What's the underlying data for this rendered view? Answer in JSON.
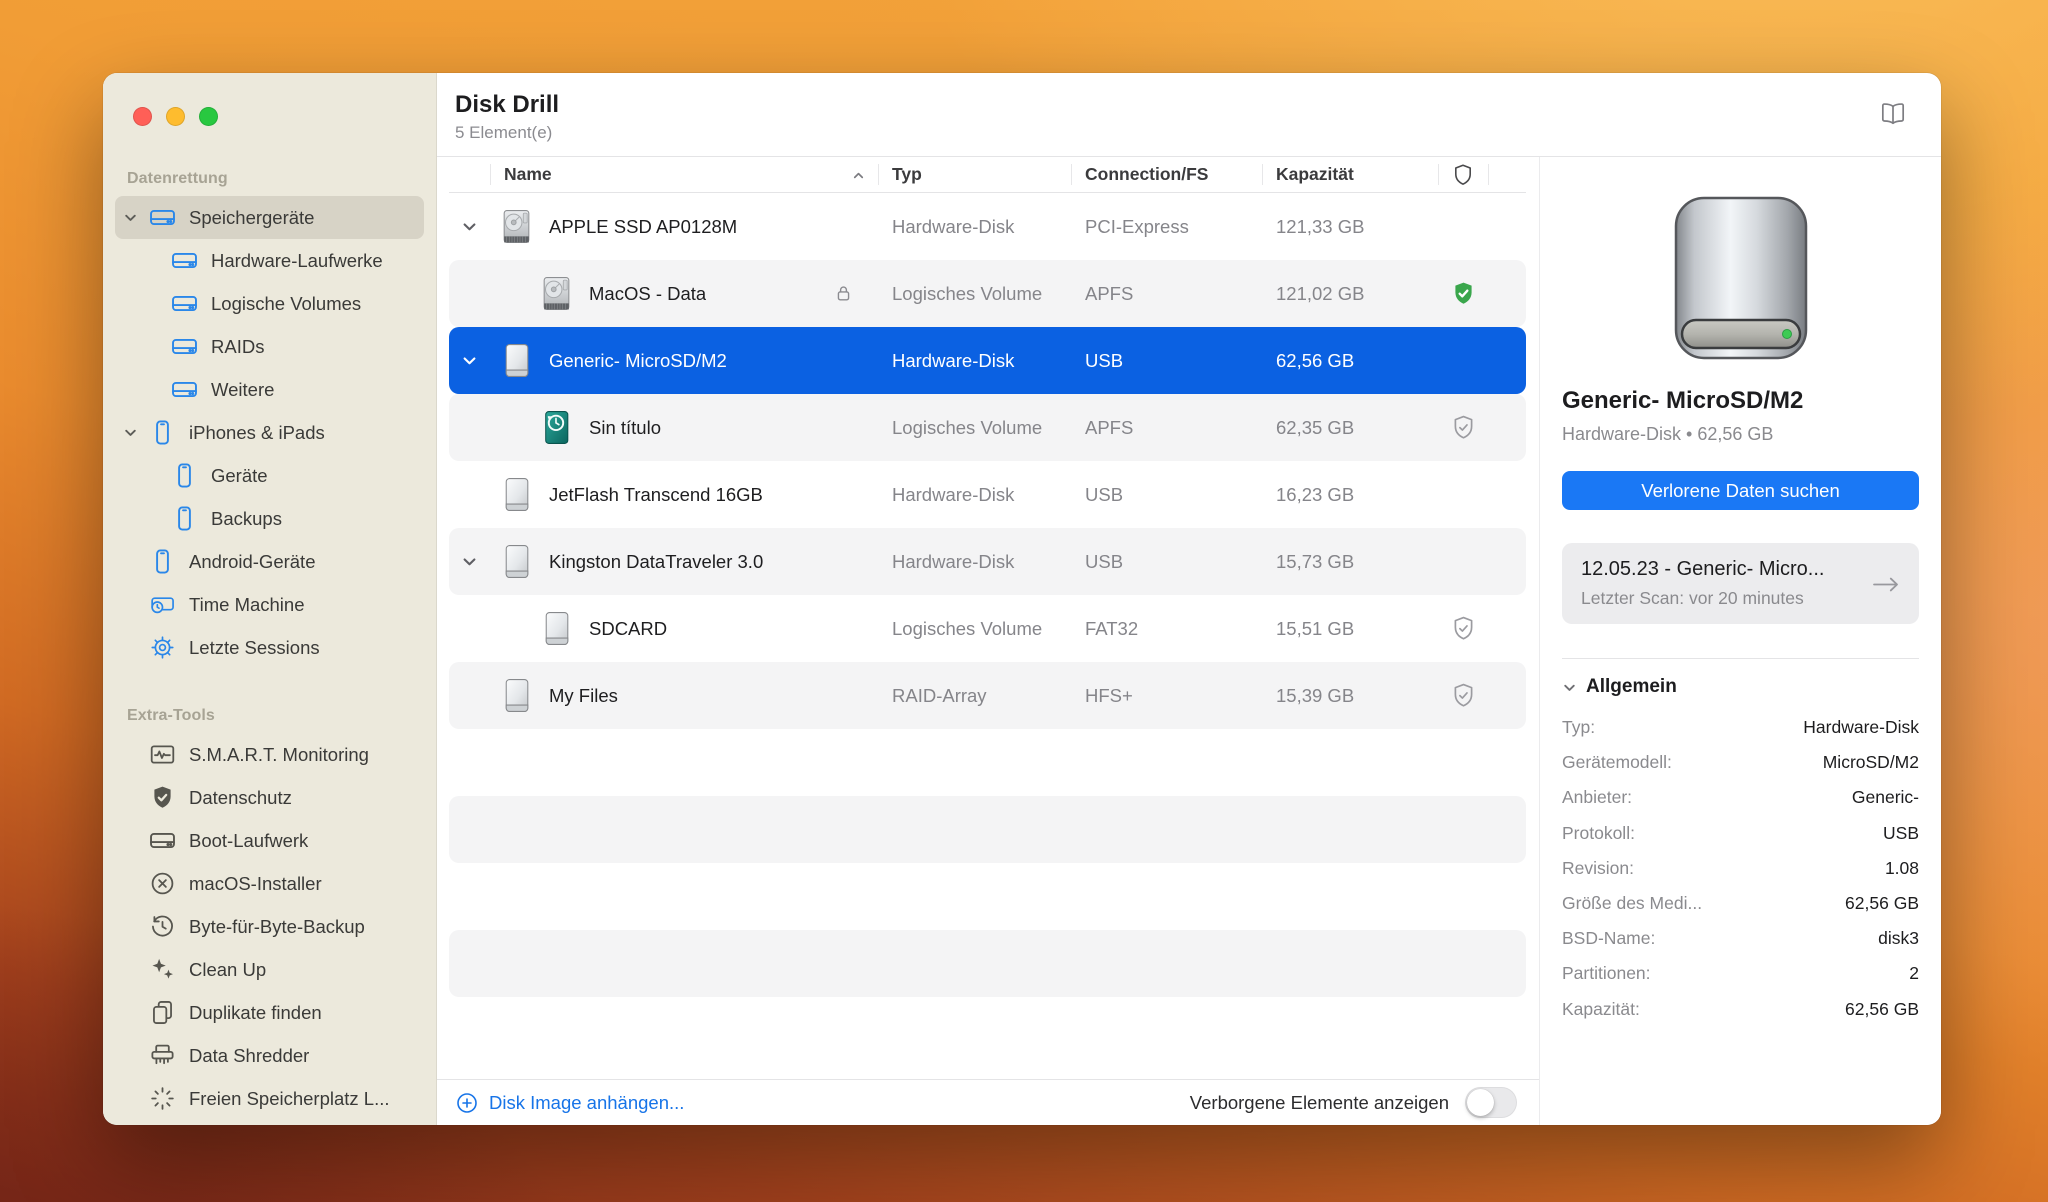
{
  "window": {
    "title": "Disk Drill",
    "subtitle": "5 Element(e)"
  },
  "colors": {
    "selection_blue": "#0b61e2",
    "button_blue": "#1a78f5",
    "link_blue": "#1774e8",
    "sidebar_icon_blue": "#2a87e9",
    "shield_green": "#3aa64c",
    "sidebar_bg": "#ece9dc"
  },
  "sidebar": {
    "sections": [
      {
        "label": "Datenrettung",
        "items": [
          {
            "label": "Speichergeräte",
            "icon": "drive",
            "level": 0,
            "chevron": true,
            "selected": true
          },
          {
            "label": "Hardware-Laufwerke",
            "icon": "drive",
            "level": 1
          },
          {
            "label": "Logische Volumes",
            "icon": "drive",
            "level": 1
          },
          {
            "label": "RAIDs",
            "icon": "drive",
            "level": 1
          },
          {
            "label": "Weitere",
            "icon": "drive",
            "level": 1
          },
          {
            "label": "iPhones & iPads",
            "icon": "iphone",
            "level": 0,
            "chevron": true
          },
          {
            "label": "Geräte",
            "icon": "iphone",
            "level": 1
          },
          {
            "label": "Backups",
            "icon": "iphone",
            "level": 1
          },
          {
            "label": "Android-Geräte",
            "icon": "iphone",
            "level": 0
          },
          {
            "label": "Time Machine",
            "icon": "tm-drive",
            "level": 0
          },
          {
            "label": "Letzte Sessions",
            "icon": "gear",
            "level": 0
          }
        ]
      },
      {
        "label": "Extra-Tools",
        "items": [
          {
            "label": "S.M.A.R.T. Monitoring",
            "icon": "monitoring",
            "gray": true
          },
          {
            "label": "Datenschutz",
            "icon": "shield-check-filled",
            "gray": true
          },
          {
            "label": "Boot-Laufwerk",
            "icon": "drive",
            "gray": true
          },
          {
            "label": "macOS-Installer",
            "icon": "x-circle",
            "gray": true
          },
          {
            "label": "Byte-für-Byte-Backup",
            "icon": "clock-arrow",
            "gray": true
          },
          {
            "label": "Clean Up",
            "icon": "sparkles",
            "gray": true
          },
          {
            "label": "Duplikate finden",
            "icon": "documents",
            "gray": true
          },
          {
            "label": "Data Shredder",
            "icon": "shredder",
            "gray": true
          },
          {
            "label": "Freien Speicherplatz L...",
            "icon": "wand",
            "gray": true
          }
        ]
      }
    ]
  },
  "table": {
    "columns": {
      "name": "Name",
      "typ": "Typ",
      "connection": "Connection/FS",
      "kapazitaet": "Kapazität"
    },
    "rows": [
      {
        "name": "APPLE SSD AP0128M",
        "typ": "Hardware-Disk",
        "connection": "PCI-Express",
        "kapazitaet": "121,33 GB",
        "icon": "hdd",
        "chevron": true,
        "child": false,
        "lock": false,
        "shield": "none",
        "selected": false
      },
      {
        "name": "MacOS - Data",
        "typ": "Logisches Volume",
        "connection": "APFS",
        "kapazitaet": "121,02 GB",
        "icon": "hdd",
        "chevron": false,
        "child": true,
        "lock": true,
        "shield": "green",
        "selected": false
      },
      {
        "name": "Generic- MicroSD/M2",
        "typ": "Hardware-Disk",
        "connection": "USB",
        "kapazitaet": "62,56 GB",
        "icon": "external",
        "chevron": true,
        "child": false,
        "lock": false,
        "shield": "none",
        "selected": true
      },
      {
        "name": "Sin título",
        "typ": "Logisches Volume",
        "connection": "APFS",
        "kapazitaet": "62,35 GB",
        "icon": "tm-volume",
        "chevron": false,
        "child": true,
        "lock": false,
        "shield": "check",
        "selected": false
      },
      {
        "name": "JetFlash Transcend 16GB",
        "typ": "Hardware-Disk",
        "connection": "USB",
        "kapazitaet": "16,23 GB",
        "icon": "external",
        "chevron": false,
        "child": false,
        "lock": false,
        "shield": "none",
        "selected": false
      },
      {
        "name": "Kingston DataTraveler 3.0",
        "typ": "Hardware-Disk",
        "connection": "USB",
        "kapazitaet": "15,73 GB",
        "icon": "external",
        "chevron": true,
        "child": false,
        "lock": false,
        "shield": "none",
        "selected": false
      },
      {
        "name": "SDCARD",
        "typ": "Logisches Volume",
        "connection": "FAT32",
        "kapazitaet": "15,51 GB",
        "icon": "external",
        "chevron": false,
        "child": true,
        "lock": false,
        "shield": "check",
        "selected": false
      },
      {
        "name": "My Files",
        "typ": "RAID-Array",
        "connection": "HFS+",
        "kapazitaet": "15,39 GB",
        "icon": "external",
        "chevron": false,
        "child": false,
        "lock": false,
        "shield": "check",
        "selected": false
      }
    ],
    "empty_filler_rows": 5,
    "footer": {
      "attach_label": "Disk Image anhängen...",
      "toggle_label": "Verborgene Elemente anzeigen",
      "toggle_on": false
    }
  },
  "details": {
    "title": "Generic- MicroSD/M2",
    "subtitle": "Hardware-Disk • 62,56 GB",
    "scan_button": "Verlorene Daten suchen",
    "session": {
      "title": "12.05.23 - Generic- Micro...",
      "subtitle": "Letzter Scan: vor 20 minutes"
    },
    "section_label": "Allgemein",
    "properties": [
      {
        "label": "Typ:",
        "value": "Hardware-Disk"
      },
      {
        "label": "Gerätemodell:",
        "value": "MicroSD/M2"
      },
      {
        "label": "Anbieter:",
        "value": "Generic-"
      },
      {
        "label": "Protokoll:",
        "value": "USB"
      },
      {
        "label": "Revision:",
        "value": "1.08"
      },
      {
        "label": "Größe des Medi...",
        "value": "62,56 GB"
      },
      {
        "label": "BSD-Name:",
        "value": "disk3"
      },
      {
        "label": "Partitionen:",
        "value": "2"
      },
      {
        "label": "Kapazität:",
        "value": "62,56 GB"
      }
    ]
  }
}
